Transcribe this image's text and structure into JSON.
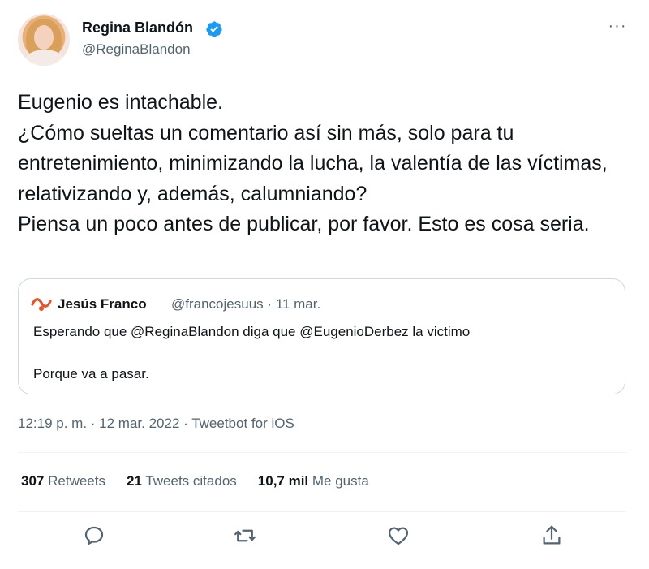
{
  "author": {
    "name": "Regina Blandón",
    "handle": "@ReginaBlandon"
  },
  "menu": {
    "more_label": "···"
  },
  "tweet": {
    "text": "Eugenio es intachable.\n¿Cómo sueltas un comentario así sin más, solo para tu entretenimiento, minimizando la lucha, la valentía de las víctimas, relativizando y, además, calumniando?\nPiensa un poco antes de publicar, por favor. Esto es cosa seria."
  },
  "quoted": {
    "name": "Jesús Franco",
    "handle_date": "@francojesuus · 11 mar.",
    "text": "Esperando que @ReginaBlandon diga que @EugenioDerbez la victimo\n\nPorque va a pasar."
  },
  "meta": {
    "timestamp": "12:19 p. m. · 12 mar. 2022 · Tweetbot for iOS"
  },
  "stats": {
    "retweets_count": "307",
    "retweets_label": "Retweets",
    "quotes_count": "21",
    "quotes_label": "Tweets citados",
    "likes_count": "10,7 mil",
    "likes_label": "Me gusta"
  },
  "colors": {
    "verified": "#1d9bf0",
    "secondary_text": "#536471",
    "border": "#cfd9de",
    "quote_icon": "#e0562b"
  },
  "icons": [
    "verified-icon",
    "more-icon",
    "quoted-user-icon",
    "reply-icon",
    "retweet-icon",
    "like-icon",
    "share-icon"
  ]
}
